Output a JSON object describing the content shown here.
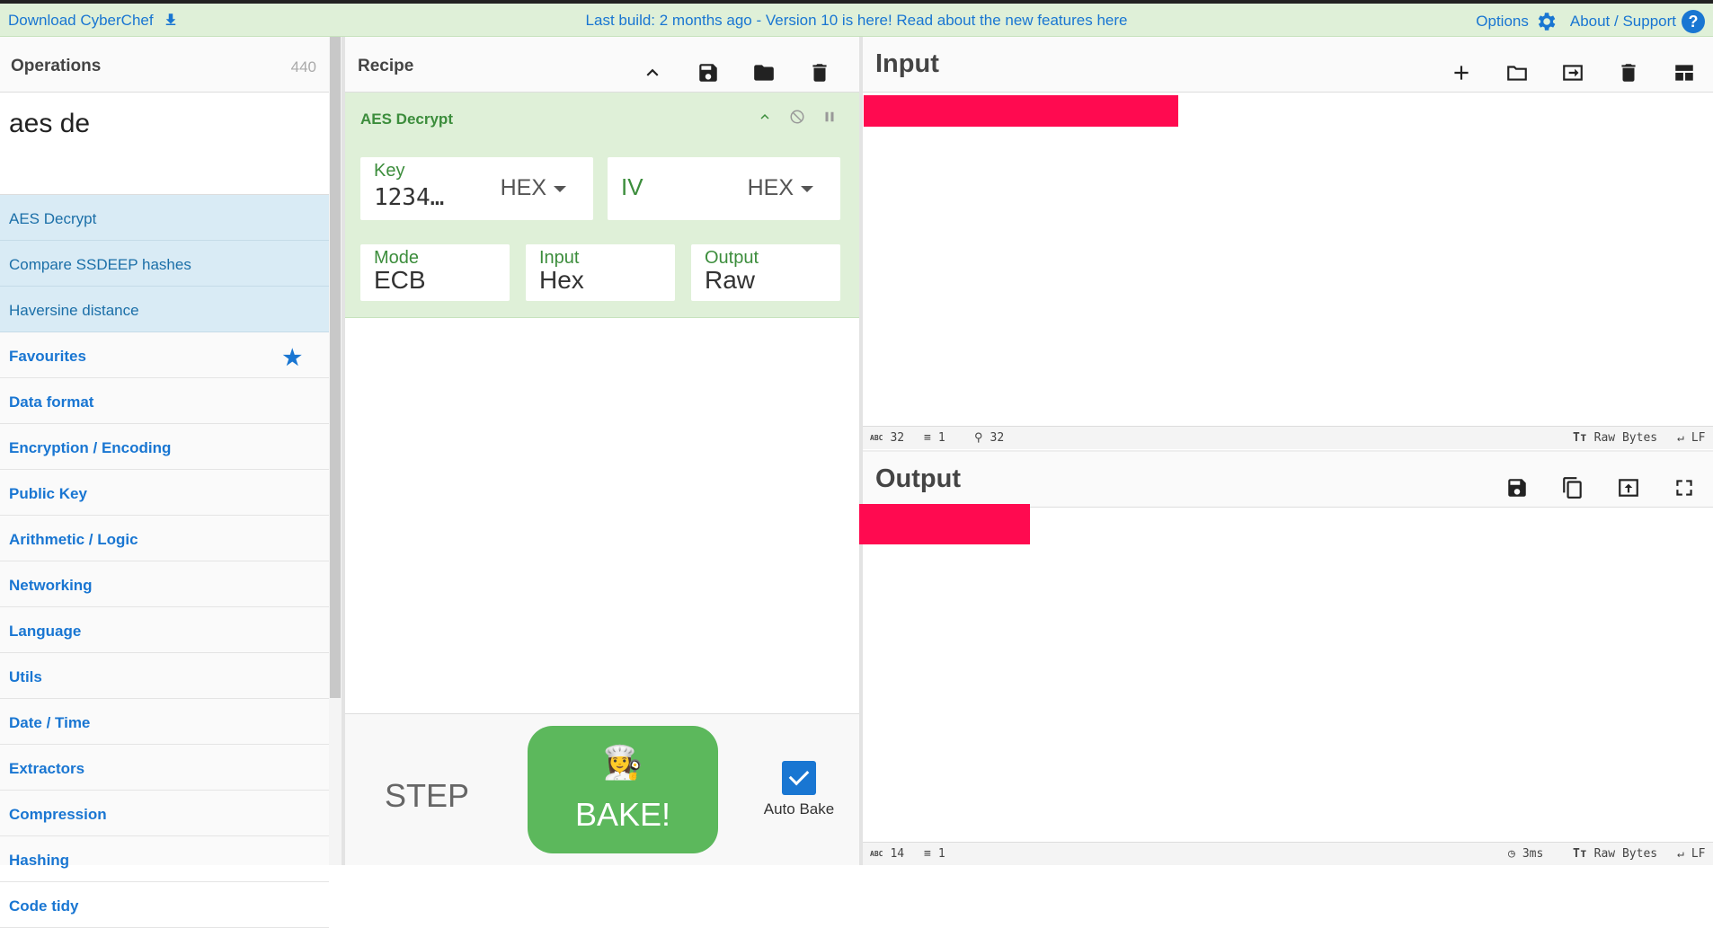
{
  "banner": {
    "download": "Download CyberChef",
    "message": "Last build: 2 months ago - Version 10 is here! Read about the new features here",
    "options": "Options",
    "about": "About / Support"
  },
  "operations": {
    "title": "Operations",
    "count": "440",
    "search_value": "aes de",
    "results": [
      "AES Decrypt",
      "Compare SSDEEP hashes",
      "Haversine distance"
    ],
    "categories": [
      "Favourites",
      "Data format",
      "Encryption / Encoding",
      "Public Key",
      "Arithmetic / Logic",
      "Networking",
      "Language",
      "Utils",
      "Date / Time",
      "Extractors",
      "Compression",
      "Hashing",
      "Code tidy"
    ]
  },
  "recipe": {
    "title": "Recipe",
    "operation": {
      "name": "AES Decrypt",
      "key_label": "Key",
      "key_value": "1234…",
      "key_format": "HEX",
      "iv_label": "IV",
      "iv_format": "HEX",
      "mode_label": "Mode",
      "mode_value": "ECB",
      "input_label": "Input",
      "input_value": "Hex",
      "output_label": "Output",
      "output_value": "Raw"
    },
    "step_label": "STEP",
    "bake_label": "BAKE!",
    "bake_emoji": "👩‍🍳",
    "auto_bake_label": "Auto Bake",
    "auto_bake_checked": true
  },
  "input": {
    "title": "Input",
    "status": {
      "chars": "32",
      "lines": "1",
      "position": "32",
      "encoding": "Raw Bytes",
      "eol": "LF"
    }
  },
  "output": {
    "title": "Output",
    "status": {
      "chars": "14",
      "lines": "1",
      "time": "3ms",
      "encoding": "Raw Bytes",
      "eol": "LF"
    }
  },
  "colors": {
    "accent": "#1976d2",
    "operation_bg": "#dff0d8",
    "bake_green": "#5cb85c",
    "redaction": "#ff0a50"
  }
}
